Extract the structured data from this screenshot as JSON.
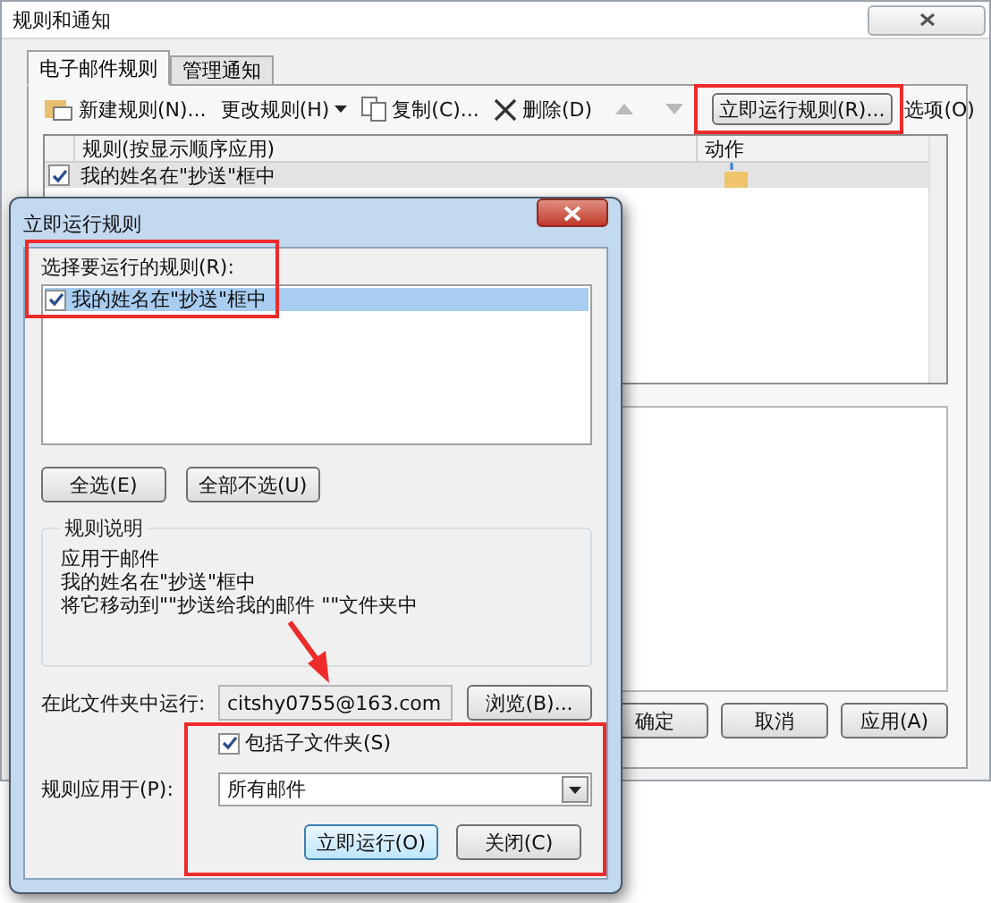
{
  "window": {
    "title": "规则和通知"
  },
  "tabs": [
    {
      "label": "电子邮件规则",
      "selected": true
    },
    {
      "label": "管理通知",
      "selected": false
    }
  ],
  "toolbar": [
    {
      "kind": "new",
      "label": "新建规则(N)..."
    },
    {
      "kind": "menu",
      "label": "更改规则(H)"
    },
    {
      "kind": "copy",
      "label": "复制(C)..."
    },
    {
      "kind": "delete",
      "label": "删除(D)"
    },
    {
      "kind": "up",
      "disabled": true
    },
    {
      "kind": "down",
      "disabled": true
    },
    {
      "kind": "button",
      "label": "立即运行规则(R)..."
    },
    {
      "kind": "plain",
      "label": "选项(O)"
    }
  ],
  "rules_table": {
    "columns": [
      "规则(按显示顺序应用)",
      "动作"
    ],
    "rows": [
      {
        "name": "我的姓名在\"抄送\"框中",
        "checked": true,
        "selected": true
      }
    ]
  },
  "footer_buttons": [
    "确定",
    "取消",
    "应用(A)"
  ],
  "run_dialog": {
    "title": "立即运行规则",
    "list_label": "选择要运行的规则(R):",
    "rules": [
      {
        "name": "我的姓名在\"抄送\"框中",
        "checked": true,
        "selected": true
      }
    ],
    "select_buttons": [
      "全选(E)",
      "全部不选(U)"
    ],
    "description": {
      "title": "规则说明",
      "lines": [
        "应用于邮件",
        "我的姓名在\"抄送\"框中",
        "将它移动到\"\"抄送给我的邮件 \"\"文件夹中"
      ]
    },
    "folder": {
      "label": "在此文件夹中运行:",
      "value": "citshy0755@163.com",
      "browse": "浏览(B)..."
    },
    "include_subfolders": {
      "label": "包括子文件夹(S)",
      "checked": true
    },
    "apply_to": {
      "label": "规则应用于(P):",
      "value": "所有邮件"
    },
    "actions": [
      {
        "label": "立即运行(O)",
        "default": true
      },
      {
        "label": "关闭(C)",
        "default": false
      }
    ]
  },
  "annotations": [
    {
      "kind": "box"
    },
    {
      "kind": "box"
    },
    {
      "kind": "box"
    },
    {
      "kind": "arrow"
    }
  ]
}
